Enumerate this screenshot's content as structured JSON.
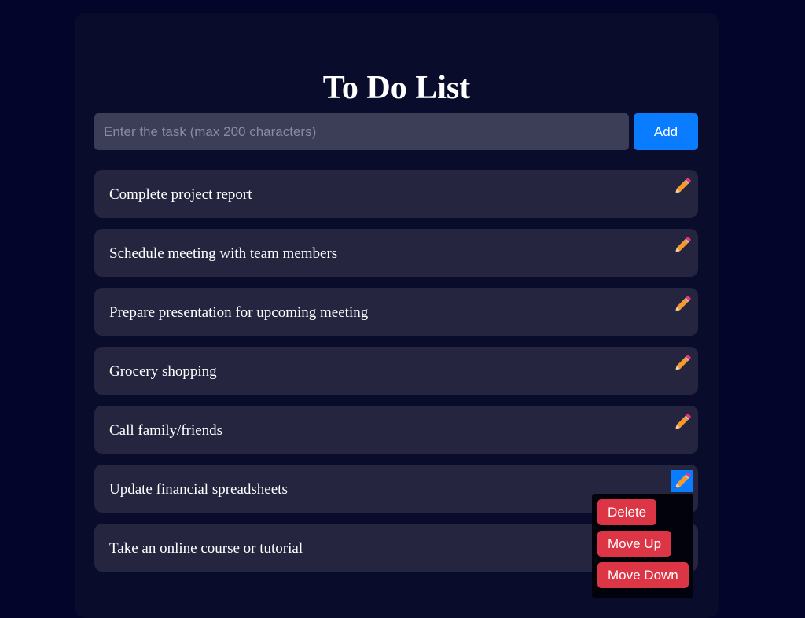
{
  "app": {
    "title": "To Do List"
  },
  "input": {
    "placeholder": "Enter the task (max 200 characters)",
    "value": ""
  },
  "add_button": {
    "label": "Add"
  },
  "tasks": [
    {
      "text": "Complete project report"
    },
    {
      "text": "Schedule meeting with team members"
    },
    {
      "text": "Prepare presentation for upcoming meeting"
    },
    {
      "text": "Grocery shopping"
    },
    {
      "text": "Call family/friends"
    },
    {
      "text": "Update financial spreadsheets"
    },
    {
      "text": "Take an online course or tutorial"
    }
  ],
  "icons": {
    "edit": "pencil-icon"
  },
  "context_menu": {
    "open_for_task": "Update financial spreadsheets",
    "delete_label": "Delete",
    "move_up_label": "Move Up",
    "move_down_label": "Move Down"
  },
  "colors": {
    "page_background": "#04052a",
    "card_background": "#0a0c2c",
    "task_background": "#252540",
    "input_background": "#3c3d56",
    "primary_button": "#0a7cff",
    "danger_button": "#dc3545"
  }
}
